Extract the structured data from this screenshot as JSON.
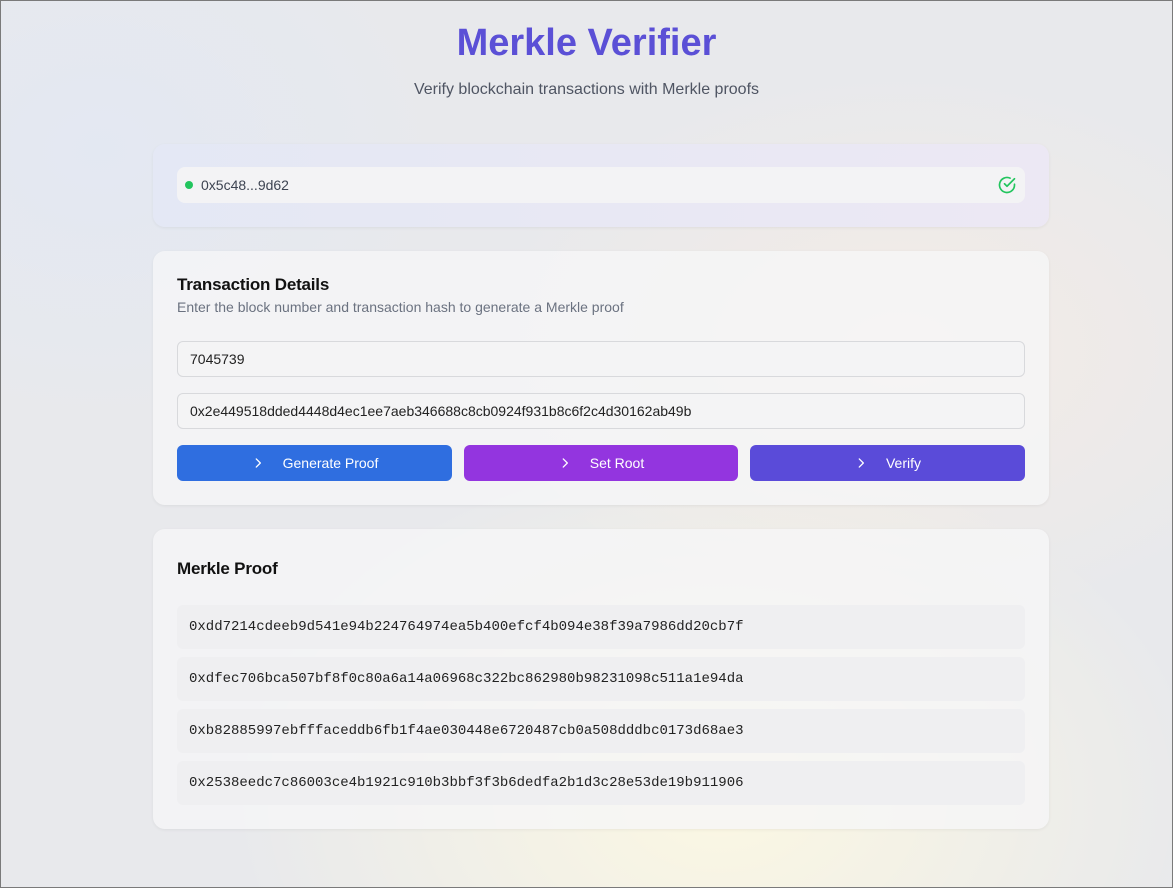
{
  "header": {
    "title": "Merkle Verifier",
    "subtitle": "Verify blockchain transactions with Merkle proofs"
  },
  "wallet": {
    "address": "0x5c48...9d62",
    "status_icon": "check-circle-icon",
    "status_color": "#22c55e"
  },
  "transaction": {
    "title": "Transaction Details",
    "description": "Enter the block number and transaction hash to generate a Merkle proof",
    "block_number": "7045739",
    "tx_hash": "0x2e449518dded4448d4ec1ee7aeb346688c8cb0924f931b8c6f2c4d30162ab49b",
    "buttons": {
      "generate_proof": "Generate Proof",
      "set_root": "Set Root",
      "verify": "Verify"
    }
  },
  "proof": {
    "title": "Merkle Proof",
    "hashes": [
      "0xdd7214cdeeb9d541e94b224764974ea5b400efcf4b094e38f39a7986dd20cb7f",
      "0xdfec706bca507bf8f0c80a6a14a06968c322bc862980b98231098c511a1e94da",
      "0xb82885997ebfffaceddb6fb1f4ae030448e6720487cb0a508dddbc0173d68ae3",
      "0x2538eedc7c86003ce4b1921c910b3bbf3f3b6dedfa2b1d3c28e53de19b911906"
    ]
  },
  "colors": {
    "title": "#5b50d6",
    "generate_button": "#2f6ee0",
    "set_root_button": "#9335df",
    "verify_button": "#5a4bd9"
  }
}
